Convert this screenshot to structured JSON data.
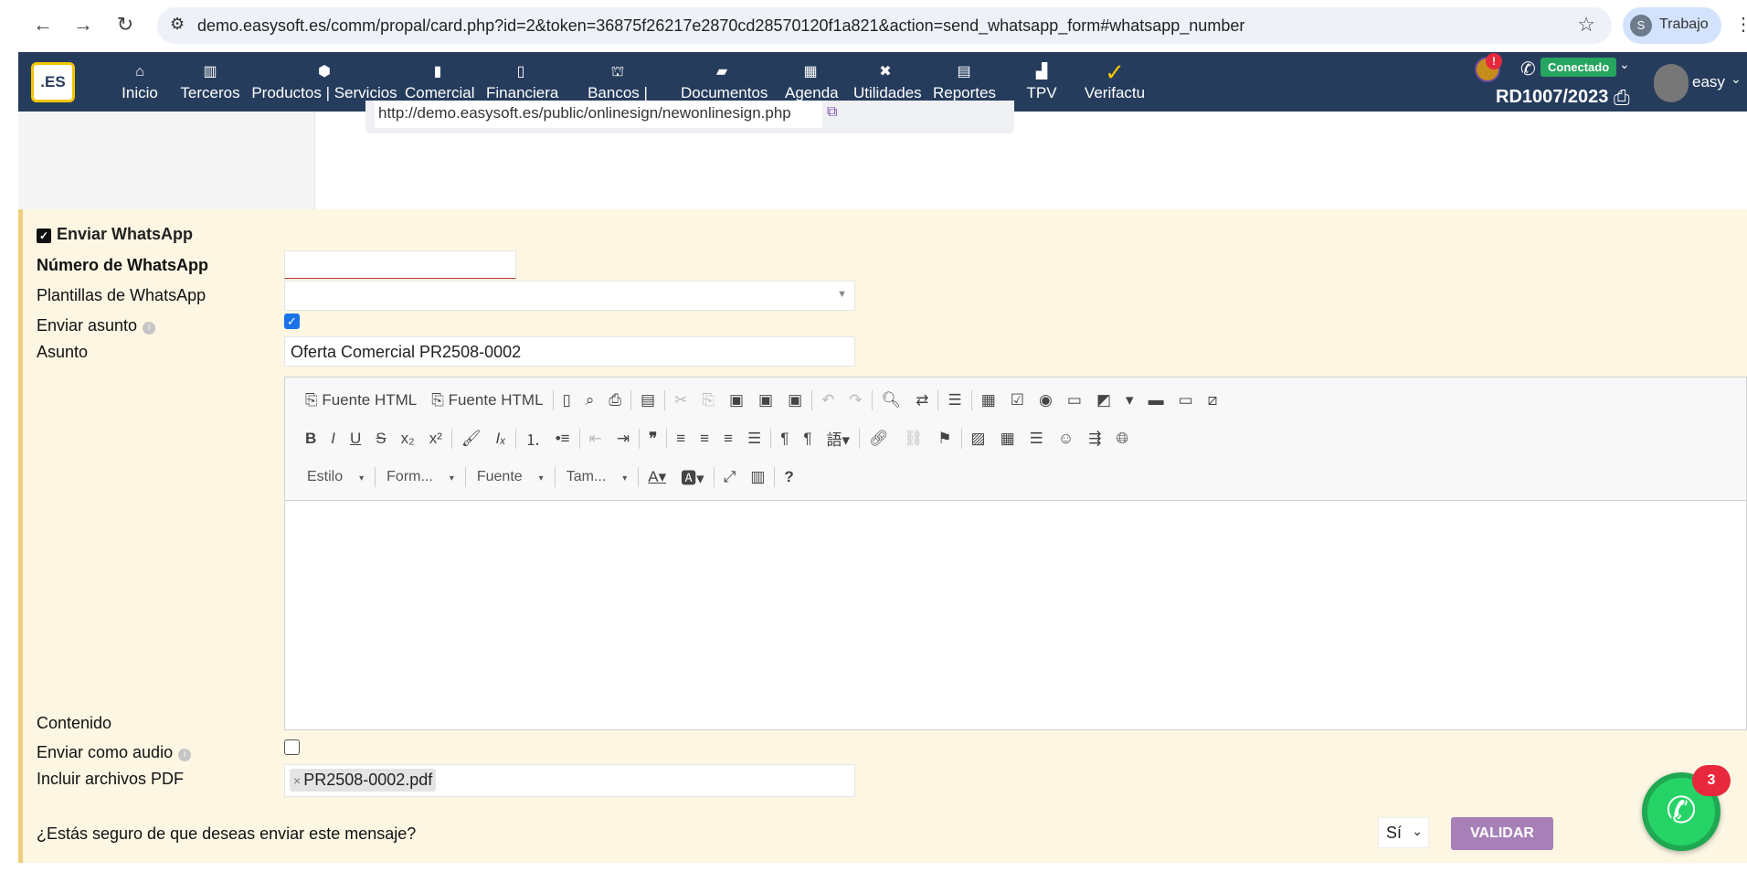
{
  "browser": {
    "url": "demo.easysoft.es/comm/propal/card.php?id=2&token=36875f26217e2870cd28570120f1a821&action=send_whatsapp_form#whatsapp_number",
    "profile_initial": "S",
    "profile_name": "Trabajo"
  },
  "nav": {
    "logo": ".ES",
    "items": [
      {
        "label": "Inicio",
        "icon": "⌂"
      },
      {
        "label": "Terceros",
        "icon": "▥"
      },
      {
        "label": "Productos | Servicios",
        "icon": "⬢"
      },
      {
        "label": "Comercial",
        "icon": "▮"
      },
      {
        "label": "Financiera",
        "icon": "▯"
      },
      {
        "label": "Bancos | Cajas",
        "icon": "⛫"
      },
      {
        "label": "Documentos",
        "icon": "▰"
      },
      {
        "label": "Agenda",
        "icon": "▦"
      },
      {
        "label": "Utilidades",
        "icon": "✖"
      },
      {
        "label": "Reportes",
        "icon": "▤"
      },
      {
        "label": "TPV",
        "icon": "▟"
      },
      {
        "label": "Verifactu",
        "icon": "✓"
      }
    ],
    "notif_badge": "!",
    "whatsapp_status": "Conectado",
    "ref": "RD1007/2023",
    "user": "easy"
  },
  "top_card": {
    "signing_url": "http://demo.easysoft.es/public/onlinesign/newonlinesign.php"
  },
  "form": {
    "title": "Enviar WhatsApp",
    "number_label": "Número de WhatsApp",
    "number_value": "",
    "templates_label": "Plantillas de WhatsApp",
    "templates_value": "",
    "send_subject_label": "Enviar asunto",
    "send_subject_checked": true,
    "subject_label": "Asunto",
    "subject_value": "Oferta Comercial PR2508-0002",
    "content_label": "Contenido",
    "audio_label": "Enviar como audio",
    "audio_checked": false,
    "pdf_label": "Incluir archivos PDF",
    "pdf_files": [
      "PR2508-0002.pdf"
    ],
    "confirm_question": "¿Estás seguro de que deseas enviar este mensaje?",
    "confirm_value": "Sí",
    "validate_label": "VALIDAR"
  },
  "editor": {
    "source1": "Fuente HTML",
    "source2": "Fuente HTML",
    "style": "Estilo",
    "format": "Form...",
    "font": "Fuente",
    "size": "Tam..."
  },
  "whatsapp_widget": {
    "count": "3"
  }
}
